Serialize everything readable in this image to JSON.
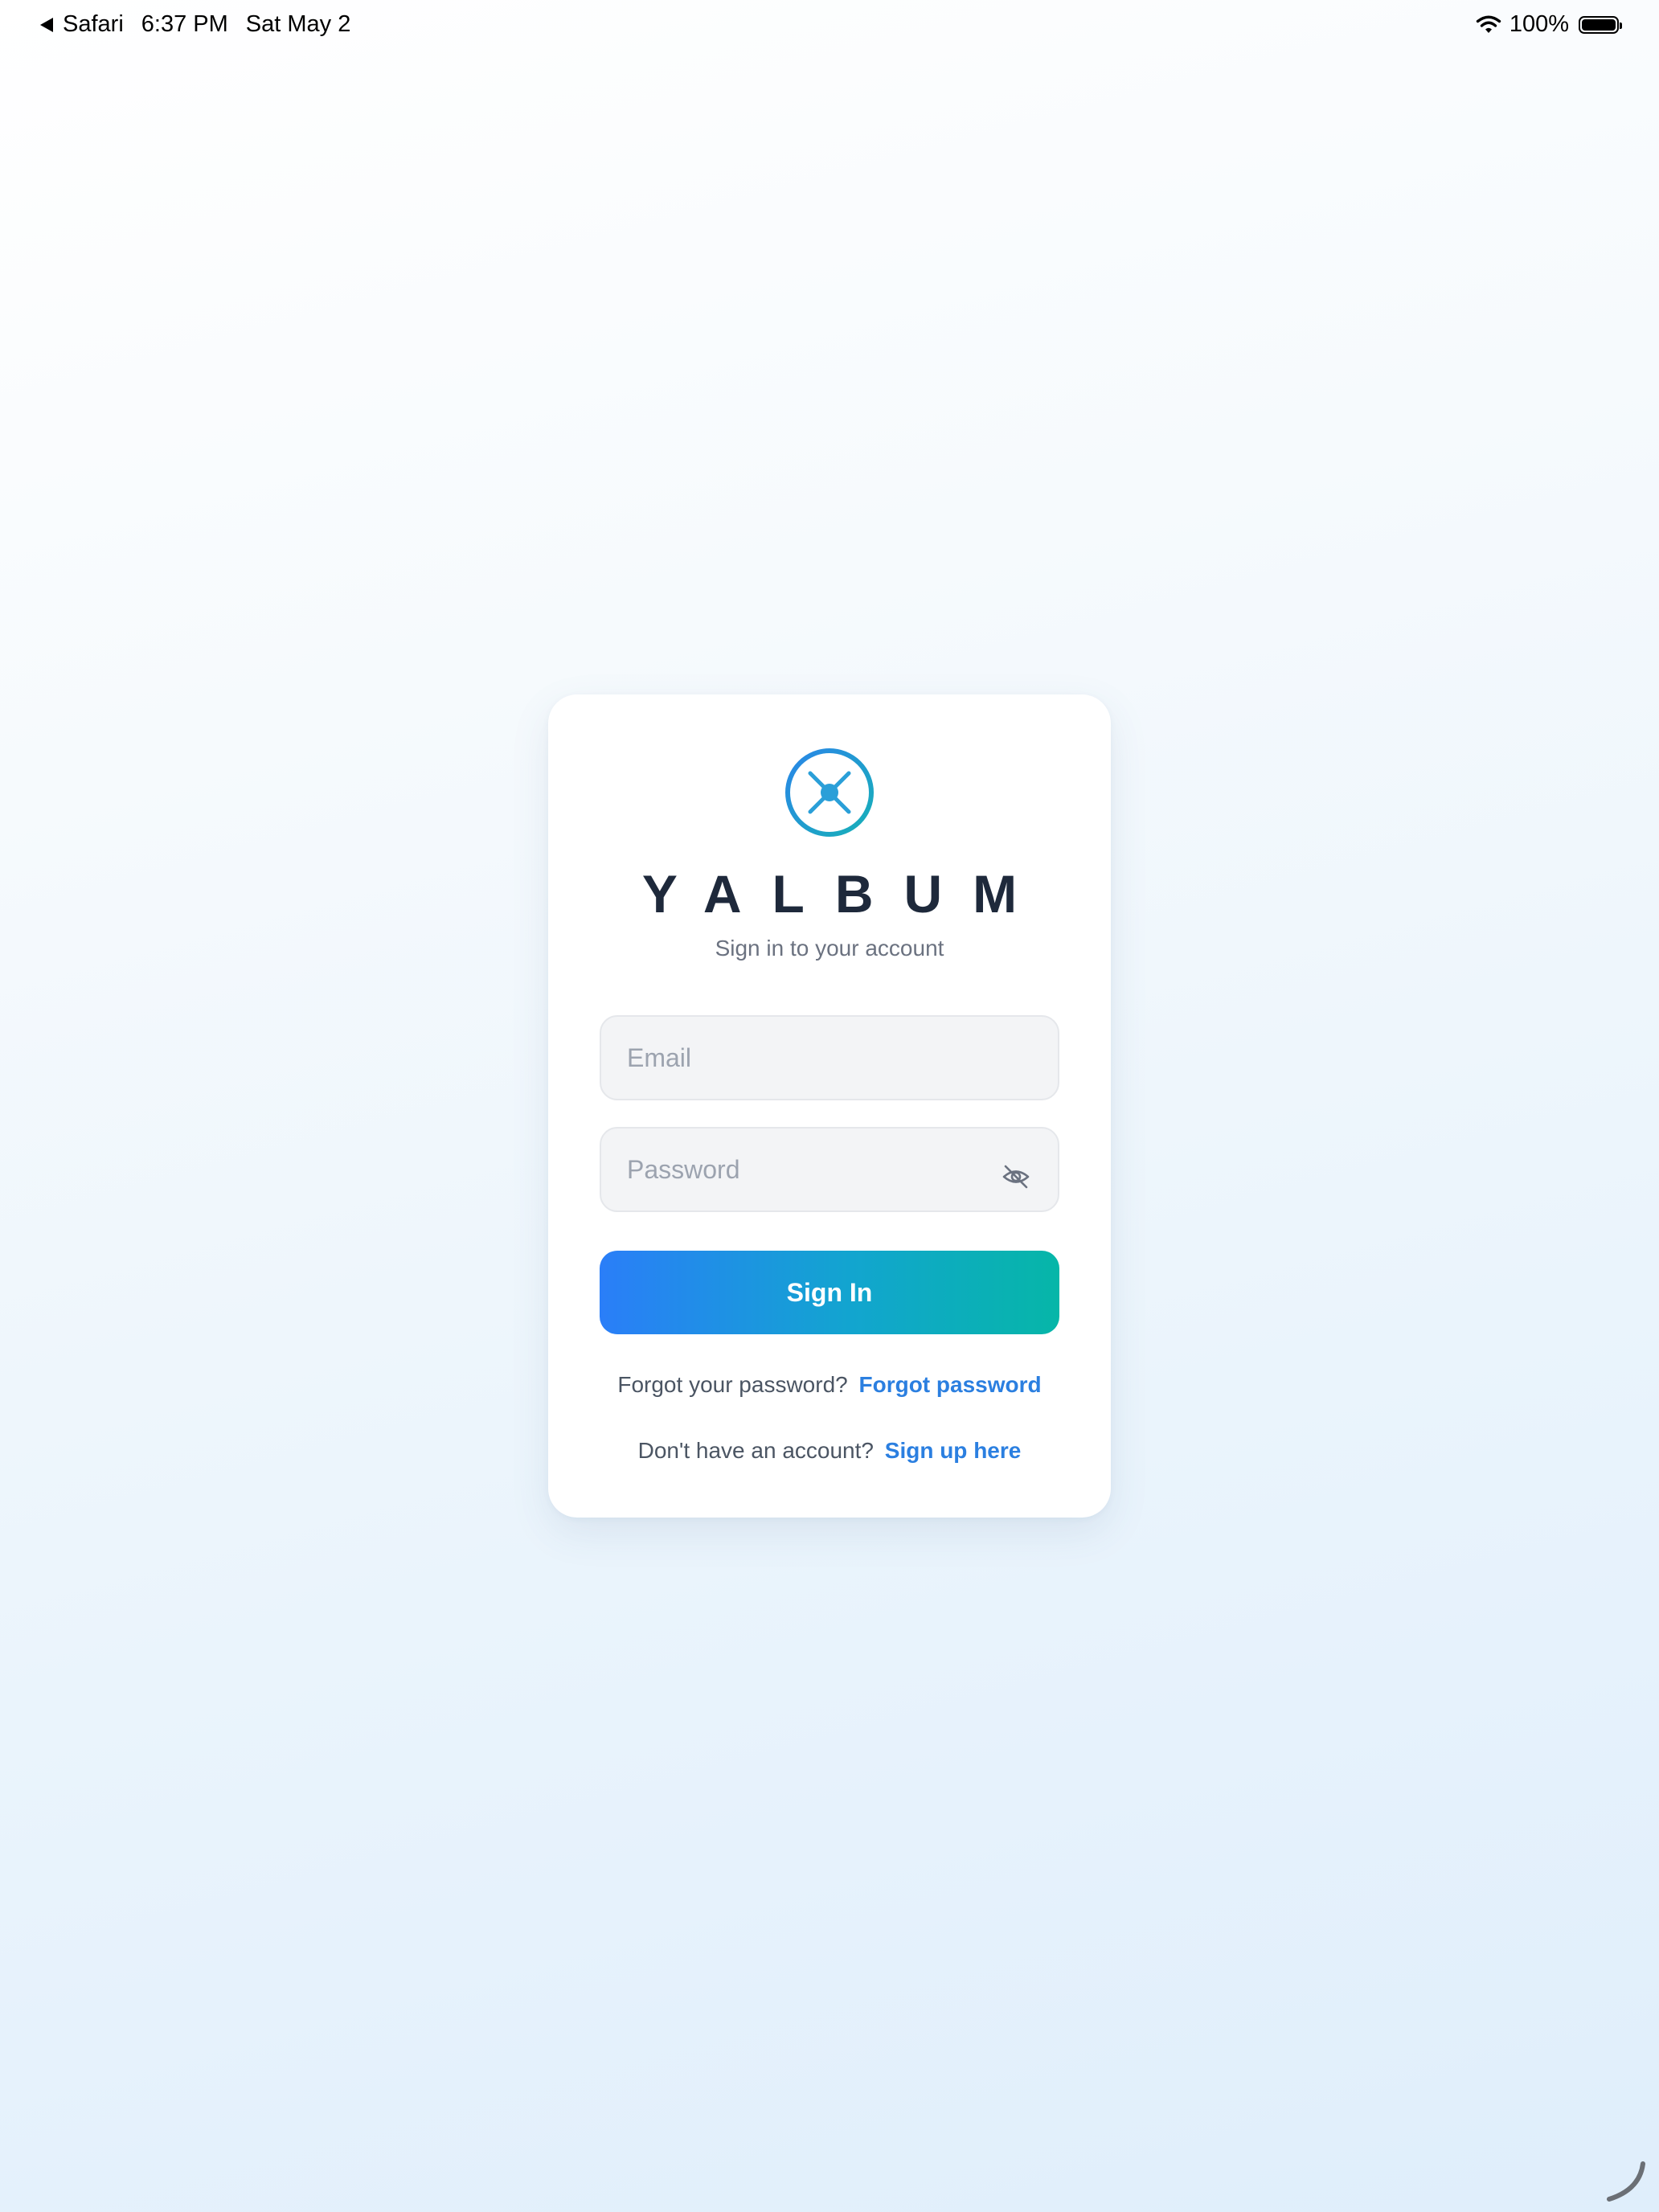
{
  "status_bar": {
    "back_app": "Safari",
    "time": "6:37 PM",
    "date": "Sat May 2",
    "battery_percent_label": "100%",
    "battery_level": 1.0
  },
  "login": {
    "brand": "YALBUM",
    "subtitle": "Sign in to your account",
    "email_placeholder": "Email",
    "email_value": "",
    "password_placeholder": "Password",
    "password_value": "",
    "signin_label": "Sign In",
    "forgot_prompt": "Forgot your password?",
    "forgot_link": "Forgot password",
    "signup_prompt": "Don't have an account?",
    "signup_link": "Sign up here"
  },
  "icons": {
    "logo": "compass-x-logo-icon",
    "password_toggle": "eye-off-icon",
    "wifi": "wifi-icon",
    "battery": "battery-icon",
    "back": "back-arrow-icon"
  },
  "colors": {
    "accent_blue": "#2a7ef8",
    "accent_teal": "#06b6a8",
    "link": "#2b7fe0",
    "brand_text": "#1e293b",
    "field_bg": "#f3f4f6"
  }
}
